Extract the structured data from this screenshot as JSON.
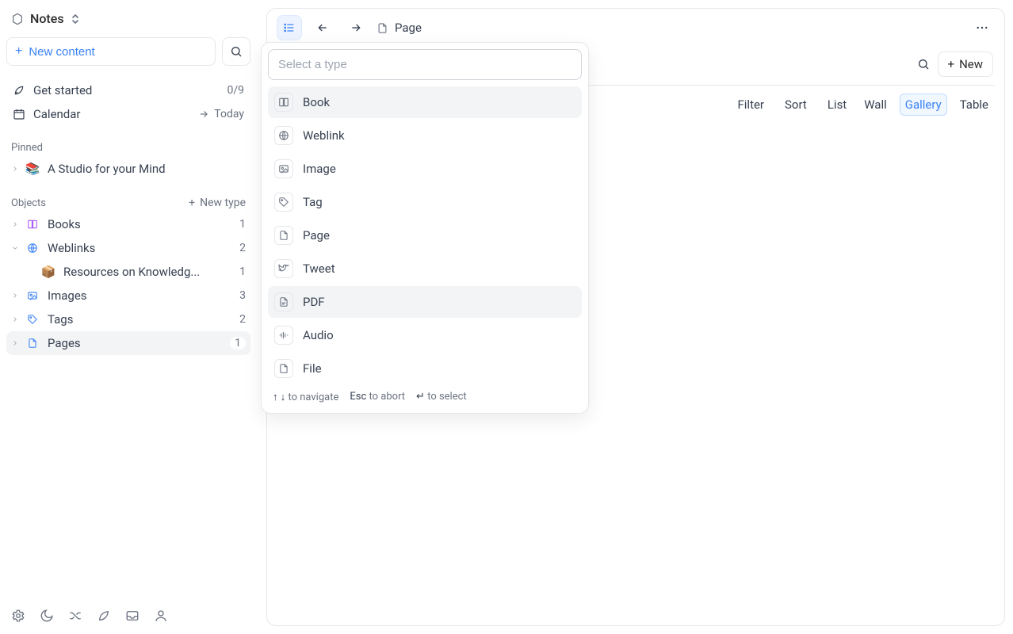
{
  "app_title": "Notes",
  "sidebar": {
    "new_content_label": "New content",
    "get_started": {
      "label": "Get started",
      "progress": "0/9"
    },
    "calendar": {
      "label": "Calendar",
      "today_label": "Today"
    },
    "pinned_label": "Pinned",
    "pinned_items": [
      {
        "label": "A Studio for your Mind",
        "emoji": "📚"
      }
    ],
    "objects_label": "Objects",
    "new_type_label": "New type",
    "object_types": [
      {
        "label": "Books",
        "count": "1",
        "expanded": false,
        "active": false,
        "children": []
      },
      {
        "label": "Weblinks",
        "count": "2",
        "expanded": true,
        "active": false,
        "children": [
          {
            "label": "Resources on Knowledg...",
            "emoji": "📦",
            "count": "1"
          }
        ]
      },
      {
        "label": "Images",
        "count": "3",
        "expanded": false,
        "active": false,
        "children": []
      },
      {
        "label": "Tags",
        "count": "2",
        "expanded": false,
        "active": false,
        "children": []
      },
      {
        "label": "Pages",
        "count": "1",
        "expanded": false,
        "active": true,
        "children": []
      }
    ]
  },
  "topbar": {
    "breadcrumb_label": "Page"
  },
  "toolbar": {
    "filter": "Filter",
    "sort": "Sort",
    "views": [
      "List",
      "Wall",
      "Gallery",
      "Table"
    ],
    "active_view": "Gallery",
    "new_label": "New"
  },
  "type_picker": {
    "placeholder": "Select a type",
    "items": [
      {
        "label": "Book",
        "icon": "book",
        "highlight": true
      },
      {
        "label": "Weblink",
        "icon": "globe",
        "highlight": false
      },
      {
        "label": "Image",
        "icon": "image",
        "highlight": false
      },
      {
        "label": "Tag",
        "icon": "tag",
        "highlight": false
      },
      {
        "label": "Page",
        "icon": "page",
        "highlight": false
      },
      {
        "label": "Tweet",
        "icon": "tweet",
        "highlight": false
      },
      {
        "label": "PDF",
        "icon": "pdf",
        "highlight": true
      },
      {
        "label": "Audio",
        "icon": "audio",
        "highlight": false
      },
      {
        "label": "File",
        "icon": "file",
        "highlight": false
      }
    ],
    "footer": {
      "nav_keys": "↑ ↓",
      "nav_label": "to navigate",
      "esc_key": "Esc",
      "esc_label": "to abort",
      "enter_key": "↵",
      "enter_label": "to select"
    }
  }
}
